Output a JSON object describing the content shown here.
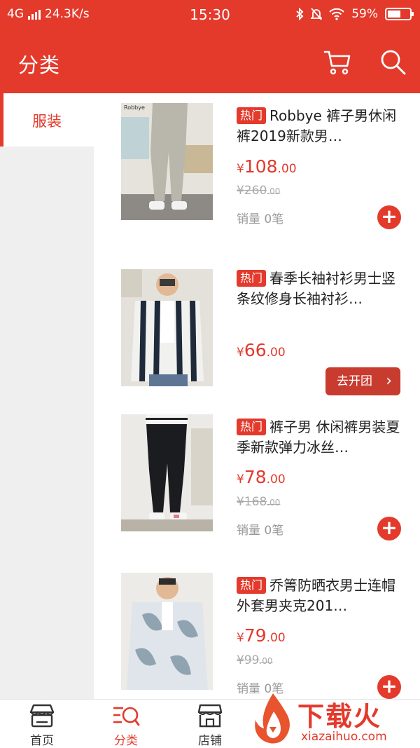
{
  "status_bar": {
    "network": "4G",
    "speed": "24.3K/s",
    "time": "15:30",
    "battery": "59%",
    "battery_level": 0.59
  },
  "header": {
    "title": "分类",
    "icons": [
      "cart-icon",
      "search-icon"
    ]
  },
  "sidebar": {
    "items": [
      {
        "label": "服装",
        "active": true
      }
    ]
  },
  "products": [
    {
      "tag": "热门",
      "name": "Robbye 裤子男休闲裤2019新款男…",
      "currency": "¥",
      "price_int": "108",
      "price_dec": ".00",
      "orig_int": "¥260",
      "orig_dec": ".00",
      "sales": "销量 0笔",
      "action": "plus"
    },
    {
      "tag": "热门",
      "name": "春季长袖衬衫男士竖条纹修身长袖衬衫…",
      "currency": "¥",
      "price_int": "66",
      "price_dec": ".00",
      "action": "group",
      "group_label": "去开团"
    },
    {
      "tag": "热门",
      "name": "裤子男 休闲裤男装夏季新款弹力冰丝…",
      "currency": "¥",
      "price_int": "78",
      "price_dec": ".00",
      "orig_int": "¥168",
      "orig_dec": ".00",
      "sales": "销量 0笔",
      "action": "plus"
    },
    {
      "tag": "热门",
      "name": "乔箐防晒衣男士连帽外套男夹克201…",
      "currency": "¥",
      "price_int": "79",
      "price_dec": ".00",
      "orig_int": "¥99",
      "orig_dec": ".00",
      "sales": "销量 0笔",
      "action": "plus"
    }
  ],
  "bottom_nav": {
    "tabs": [
      {
        "label": "首页",
        "icon": "store-icon",
        "active": false
      },
      {
        "label": "分类",
        "icon": "category-search-icon",
        "active": true
      },
      {
        "label": "店铺",
        "icon": "shop-icon",
        "active": false
      }
    ]
  },
  "watermark": {
    "title": "下载火",
    "url": "xiazaihuo.com"
  },
  "colors": {
    "accent": "#e33a2c",
    "group_button": "#c83b2f",
    "rail_bg": "#efefef"
  }
}
